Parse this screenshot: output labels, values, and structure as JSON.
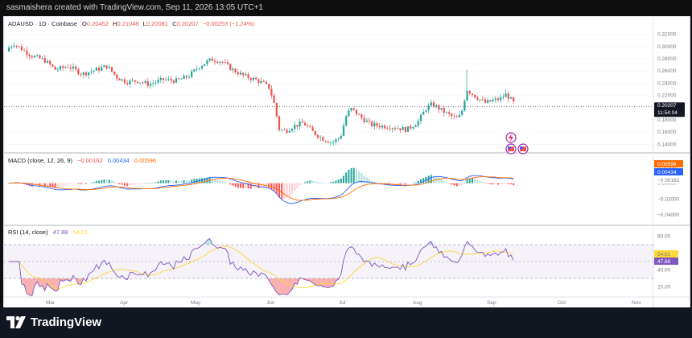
{
  "header": {
    "credit": "sasmaishera created with TradingView.com, Sep 11, 2026 13:05 UTC+1"
  },
  "price_pane": {
    "symbol": "ADAUSD · 1D · Coinbase",
    "o_label": "O",
    "o": "0.20452",
    "h_label": "H",
    "h": "0.21048",
    "l_label": "L",
    "l": "0.20081",
    "c_label": "C",
    "c": "0.20207",
    "change": "−0.00253 (−1.24%)",
    "last_price": "0.20207",
    "countdown": "11:54:04",
    "axis": [
      "0.32000",
      "0.30000",
      "0.28000",
      "0.26000",
      "0.24000",
      "0.22000",
      "0.20000",
      "0.18000",
      "0.16000",
      "0.14000"
    ]
  },
  "macd_pane": {
    "label": "MACD (close, 12, 26, 9)",
    "hist": "−0.00162",
    "macd": "0.00434",
    "signal": "0.00596",
    "badge_signal": "0.00596",
    "badge_macd": "0.00434",
    "badge_hist": "−0.00162",
    "axis": [
      "0.02000",
      "0.00000",
      "−0.02000",
      "−0.04000"
    ]
  },
  "rsi_pane": {
    "label": "RSI (14, close)",
    "rsi": "47.88",
    "ma": "54.61",
    "badge_ma": "54.61",
    "badge_rsi": "47.88",
    "axis": [
      "80.00",
      "60.00",
      "40.00",
      "20.00"
    ]
  },
  "time_axis": [
    "Mar",
    "Apr",
    "May",
    "Jun",
    "Jul",
    "Aug",
    "Sep",
    "Oct",
    "Nov"
  ],
  "footer": {
    "brand": "TradingView"
  },
  "colors": {
    "up": "#26a69a",
    "down": "#ef5350",
    "macd_line": "#2962ff",
    "signal_line": "#ff6d00",
    "rsi_line": "#7e57c2",
    "rsi_ma": "#fdd835",
    "hist_up_strong": "#26a69a",
    "hist_up_weak": "#b2dfdb",
    "hist_down_strong": "#ff5252",
    "hist_down_weak": "#ffcdd2"
  },
  "chart_data": {
    "type": "candlestick",
    "x": [
      "Mar",
      "Apr",
      "May",
      "Jun",
      "Jul",
      "Aug",
      "Sep"
    ],
    "close_trend": [
      0.3,
      0.24,
      0.285,
      0.16,
      0.18,
      0.22,
      0.202
    ],
    "ylim": [
      0.13,
      0.33
    ],
    "rsi_ylim": [
      0,
      100
    ],
    "rsi_band": [
      30,
      70
    ],
    "last_close": 0.20207
  }
}
